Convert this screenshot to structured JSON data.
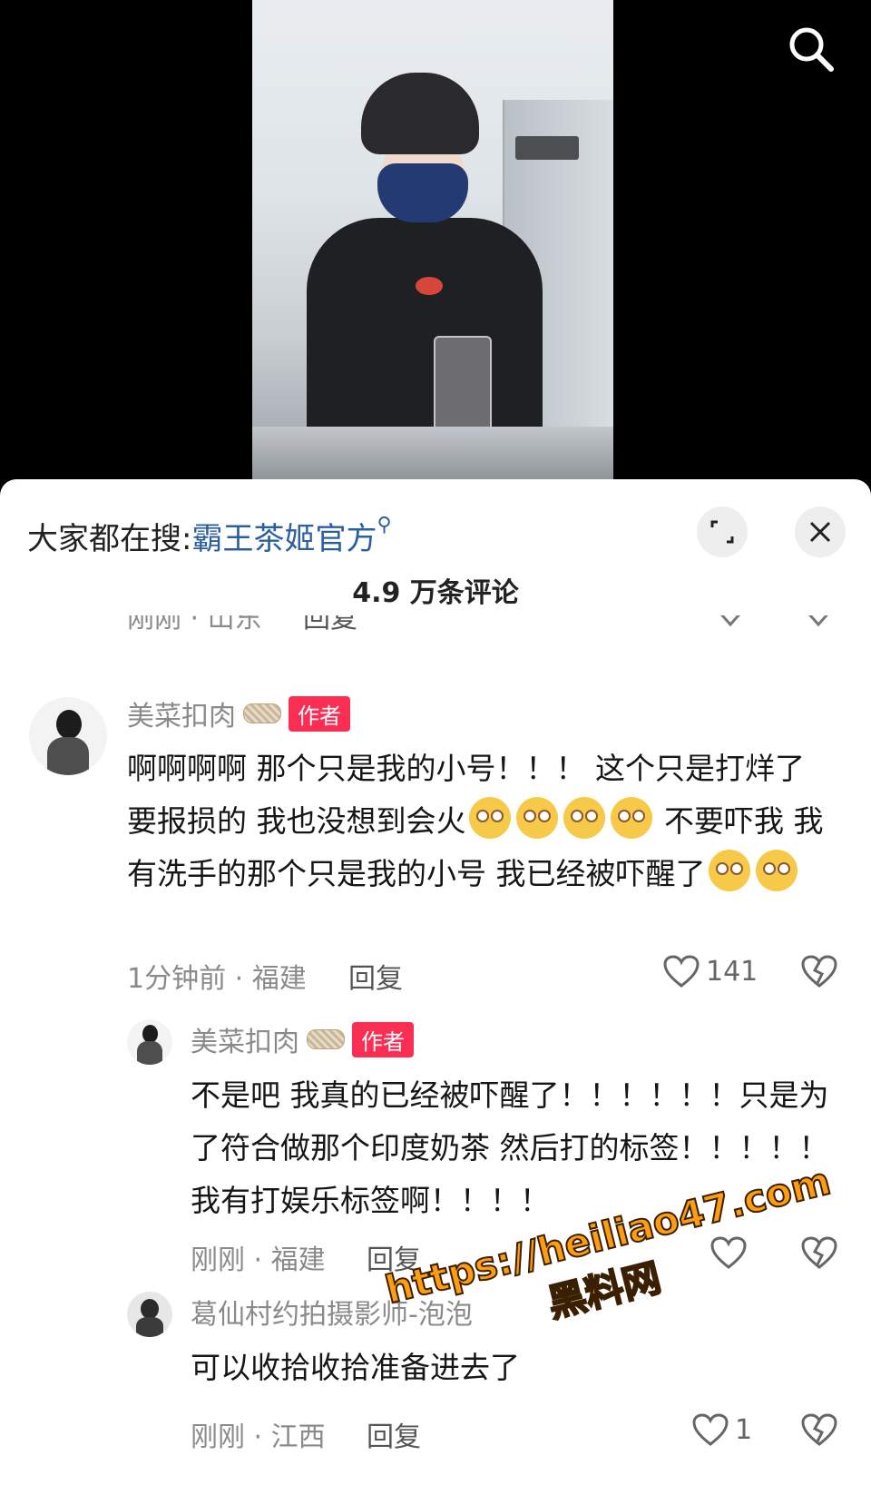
{
  "video": {
    "search_icon": "search-icon"
  },
  "panel": {
    "hot_search_prefix": "大家都在搜:",
    "hot_search_term": "霸王茶姬官方",
    "expand_icon": "expand-icon",
    "close_icon": "close-icon",
    "comment_count": "4.9 万条评论"
  },
  "comments": {
    "previous": {
      "meta": "刚刚 · 山东",
      "reply_label": "回复"
    },
    "main": {
      "author": "美菜扣肉",
      "author_tag": "作者",
      "text_parts": [
        "啊啊啊啊 那个只是我的小号！！！ 这个只是打烊了 要报损的 我也没想到会火",
        " 不要吓我 我有洗手的那个只是我的小号 我已经被吓醒了"
      ],
      "emoji_name": "flushed-face-emoji",
      "meta": "1分钟前 · 福建",
      "reply_label": "回复",
      "likes": "141"
    },
    "reply1": {
      "author": "美菜扣肉",
      "author_tag": "作者",
      "text": "不是吧 我真的已经被吓醒了！！！！！！只是为了符合做那个印度奶茶 然后打的标签！！！！！ 我有打娱乐标签啊！！！！",
      "meta": "刚刚 · 福建",
      "reply_label": "回复"
    },
    "reply2": {
      "author": "葛仙村约拍摄影师-泡泡",
      "text": "可以收拾收拾准备进去了",
      "meta": "刚刚 · 江西",
      "reply_label": "回复",
      "likes": "1"
    }
  },
  "watermark": {
    "url": "https://heiliao47.com",
    "site_name": "黑料网"
  },
  "colors": {
    "link_blue": "#2a5fa0",
    "author_tag_red": "#fa2e53",
    "watermark_orange": "#ff9d12"
  }
}
